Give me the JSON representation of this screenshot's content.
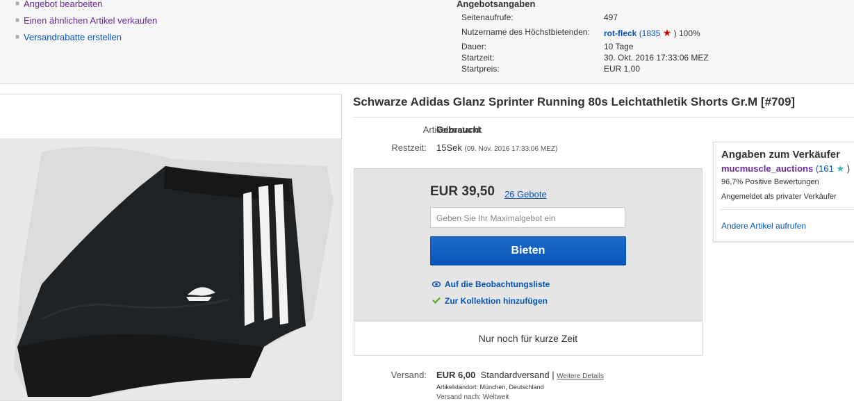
{
  "actions": [
    "Angebot bearbeiten",
    "Einen ähnlichen Artikel verkaufen",
    "Versandrabatte erstellen"
  ],
  "offer": {
    "heading": "Angebotsangaben",
    "page_views_label": "Seitenaufrufe:",
    "page_views": "497",
    "highest_bidder_label": "Nutzername des Höchstbietenden:",
    "highest_bidder": "rot-fleck",
    "bidder_score_open": "(1835",
    "bidder_score_close": ")",
    "bidder_positive": "100%",
    "duration_label": "Dauer:",
    "duration": "10 Tage",
    "start_time_label": "Startzeit:",
    "start_time": "30. Okt. 2016 17:33:06 MEZ",
    "start_price_label": "Startpreis:",
    "start_price": "EUR 1,00"
  },
  "item": {
    "title": "Schwarze Adidas Glanz Sprinter Running 80s Leichtathletik Shorts Gr.M [#709]",
    "condition_label": "Artikelzustand:",
    "condition": "Gebraucht",
    "time_left_label": "Restzeit:",
    "time_left": "15Sek",
    "end_time": "(09. Nov. 2016   17:33:06 MEZ)"
  },
  "bid": {
    "price": "EUR 39,50",
    "bids": "26 Gebote",
    "max_bid_placeholder": "Geben Sie Ihr Maximalgebot ein",
    "bid_button": "Bieten",
    "watchlist": "Auf die Beobachtungsliste",
    "collection": "Zur Kollektion hinzufügen",
    "scarcity": "Nur noch für kurze Zeit"
  },
  "shipping": {
    "label": "Versand:",
    "price": "EUR 6,00",
    "method": "Standardversand |",
    "details": "Weitere Details",
    "location": "Artikelstandort:  München, Deutschland",
    "cut_line": "Versand nach: Weltweit"
  },
  "seller": {
    "heading": "Angaben zum Verkäufer",
    "name": "mucmuscle_auctions",
    "score_open": "(161",
    "score_close": ")",
    "positive": "96,7% Positive Bewertungen",
    "type": "Angemeldet als privater Verkäufer",
    "other_items": "Andere Artikel aufrufen"
  },
  "icons": {
    "bidder_star": "red-star-icon",
    "seller_star": "teal-star-icon",
    "watch": "eye-icon",
    "collection": "checkmark-icon"
  },
  "colors": {
    "link": "#0654ba",
    "visited": "#6b2a9a",
    "button": "#0654ba",
    "collection_check": "#5ba71b"
  }
}
